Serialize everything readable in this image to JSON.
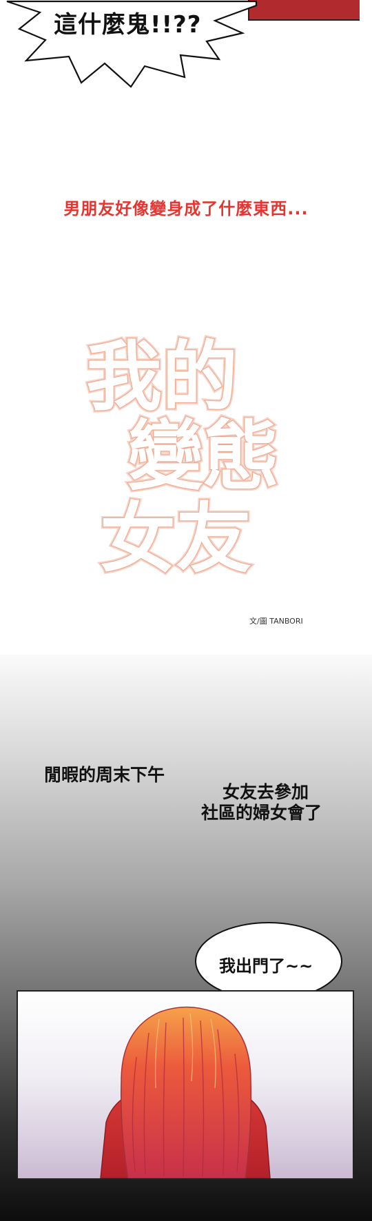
{
  "panel_1": {
    "shout_text": "這什麼鬼!!??"
  },
  "teaser": {
    "text": "男朋友好像變身成了什麼東西..."
  },
  "title_logo": {
    "line_1": "我的",
    "line_2": "變態",
    "line_3": "女友"
  },
  "credit": {
    "text": "文/圖 TANBORI"
  },
  "panel_2": {
    "caption_1": "閒暇的周末下午",
    "caption_2_line_1": "女友去參加",
    "caption_2_line_2": "社區的婦女會了",
    "speech": "我出門了~~"
  },
  "colors": {
    "teaser_red": "#e8342f",
    "logo_outline": "#f0a68c",
    "hair_red": "#e84a3a",
    "shirt_red": "#c62828"
  }
}
